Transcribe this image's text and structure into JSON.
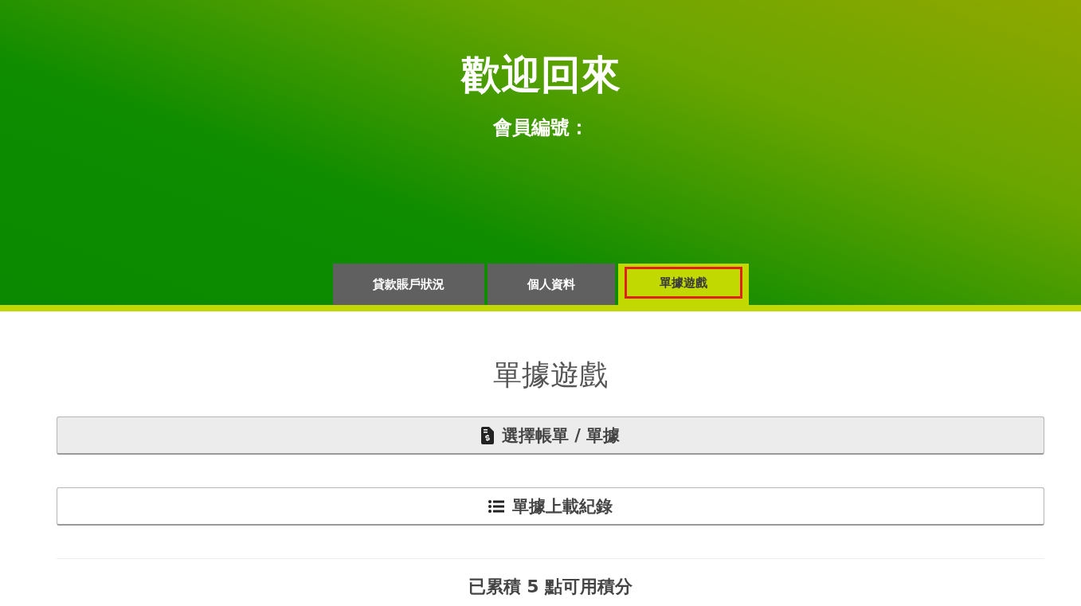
{
  "header": {
    "title": "歡迎回來",
    "member_label": "會員編號："
  },
  "tabs": [
    {
      "label": "貸款賬戶狀況",
      "selected": false
    },
    {
      "label": "個人資料",
      "selected": false
    },
    {
      "label": "單據遊戲",
      "selected": true
    }
  ],
  "section_title": "單據遊戲",
  "buttons": [
    {
      "kind": "bill",
      "label": "選擇帳單 / 單據"
    },
    {
      "kind": "list",
      "label": "單據上載紀錄"
    }
  ],
  "points_text": "已累積 5 點可用積分"
}
